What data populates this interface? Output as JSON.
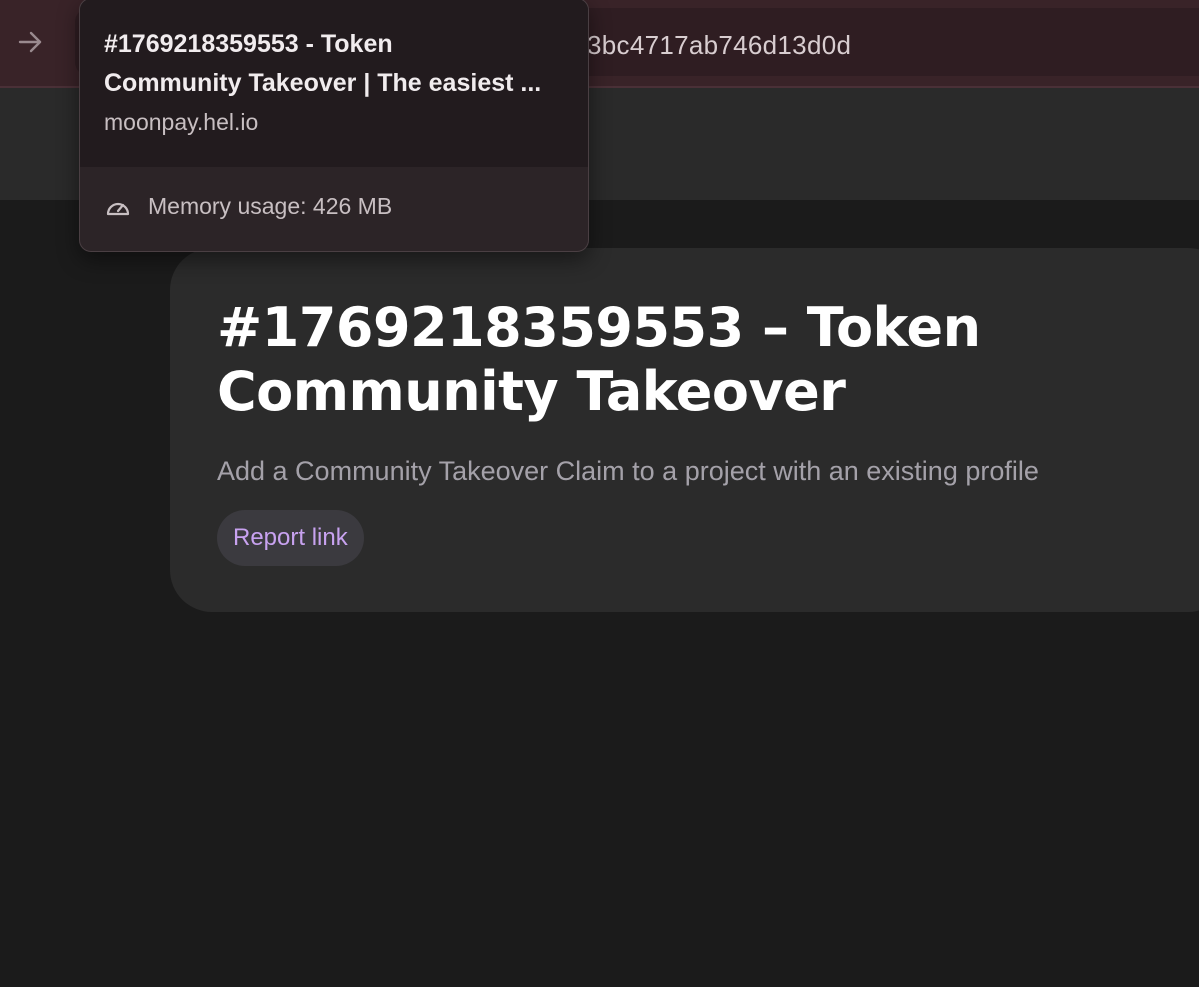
{
  "browser": {
    "address_bar_text": "3bc4717ab746d13d0d",
    "forward_icon": "arrow-right-icon"
  },
  "tab_hover_card": {
    "title_line1": "#1769218359553 - Token",
    "title_line2": "Community Takeover | The easiest ...",
    "domain": "moonpay.hel.io",
    "memory_usage": "Memory usage: 426 MB",
    "memory_icon": "speedometer-icon"
  },
  "page": {
    "title_line1": "#1769218359553 – Token",
    "title_line2": "Community Takeover",
    "subtitle": "Add a Community Takeover Claim to a project with an existing profile",
    "report_link_label": "Report link"
  },
  "colors": {
    "toolbar": "#392328",
    "page_background": "#1b1b1b",
    "card_background": "#2b2b2b",
    "report_link_text": "#c8a2f0"
  }
}
